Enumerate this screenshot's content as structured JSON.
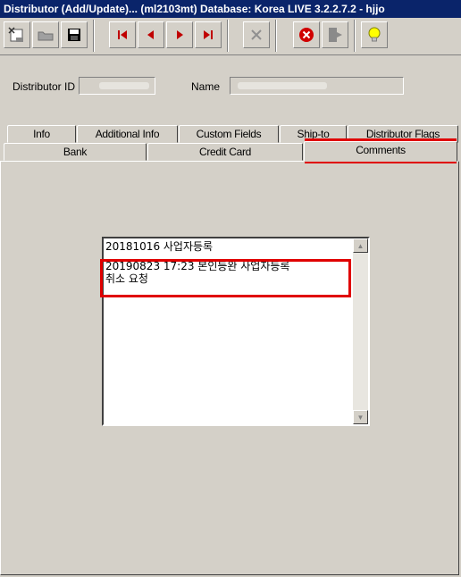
{
  "window": {
    "title": "Distributor (Add/Update)... (ml2103mt)  Database: Korea LIVE 3.2.2.7.2 - hjjo"
  },
  "toolbar": {
    "buttons": [
      {
        "name": "new-record-icon"
      },
      {
        "name": "open-folder-icon"
      },
      {
        "name": "save-icon"
      },
      {
        "name": "first-record-icon"
      },
      {
        "name": "previous-record-icon"
      },
      {
        "name": "next-record-icon"
      },
      {
        "name": "last-record-icon"
      },
      {
        "name": "delete-icon"
      },
      {
        "name": "cancel-icon"
      },
      {
        "name": "exit-icon"
      },
      {
        "name": "hint-bulb-icon"
      }
    ]
  },
  "form": {
    "distributor_id_label": "Distributor ID",
    "name_label": "Name"
  },
  "tabs": {
    "row1": [
      "Info",
      "Additional Info",
      "Custom Fields",
      "Ship-to",
      "Distributor Flags"
    ],
    "row2": [
      "Bank",
      "Credit Card",
      "Comments"
    ],
    "active": "Comments"
  },
  "comments": {
    "lines": [
      "20181016 사업자등록",
      "",
      "20190823 17:23 본인등완 사업자등록",
      "취소 요청"
    ]
  },
  "colors": {
    "titlebar": "#0a246a",
    "highlight": "#e00000",
    "window_bg": "#d4d0c8"
  }
}
